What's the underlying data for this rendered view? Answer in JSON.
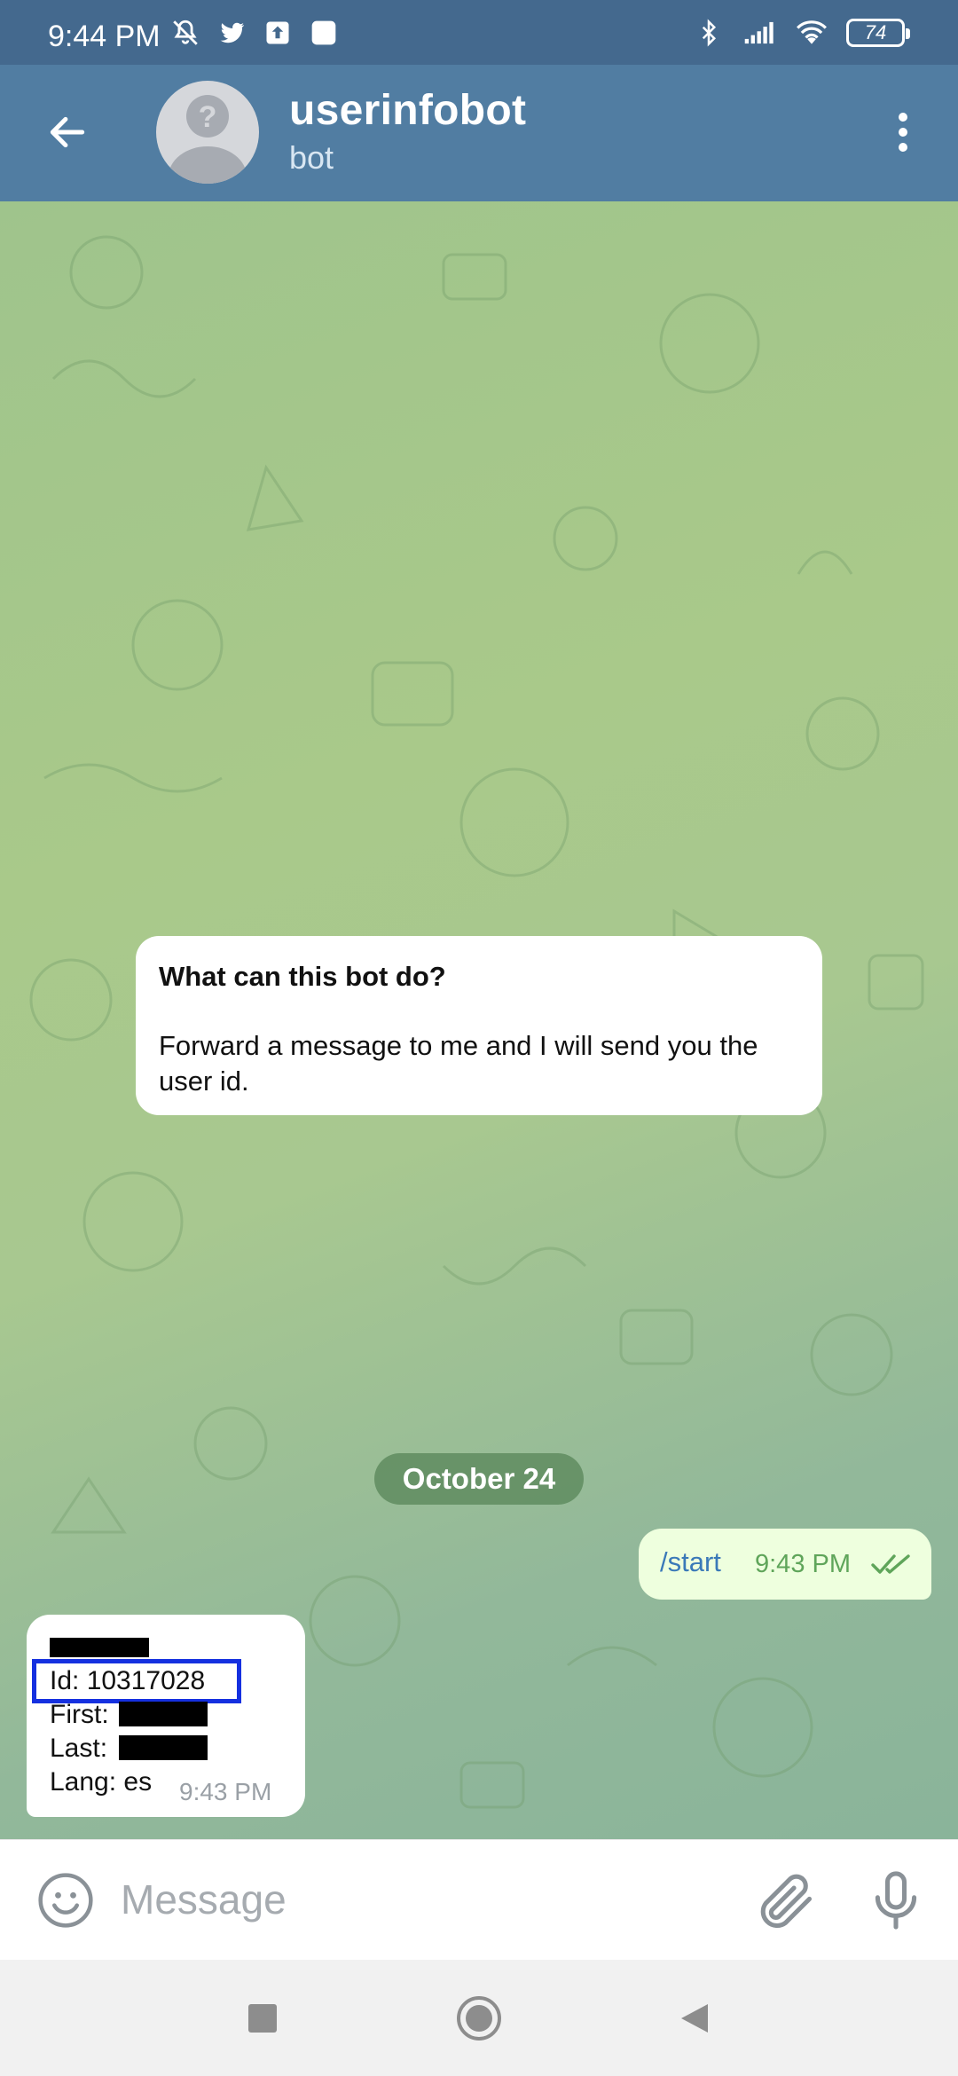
{
  "status_bar": {
    "time": "9:44 PM",
    "battery": "74",
    "icons": [
      "mute-icon",
      "twitter-icon",
      "upload-icon",
      "app-icon",
      "bluetooth-icon",
      "signal-icon",
      "wifi-icon",
      "battery-icon"
    ]
  },
  "header": {
    "title": "userinfobot",
    "subtitle": "bot",
    "icons": [
      "back-arrow-icon",
      "avatar-placeholder-icon",
      "more-vertical-icon"
    ]
  },
  "chat": {
    "bot_intro": {
      "title": "What can this bot do?",
      "body": "Forward a message to me and I will send you the user id."
    },
    "date_separator": "October 24",
    "outgoing": {
      "text": "/start",
      "time": "9:43 PM",
      "status_icon": "double-check-icon"
    },
    "incoming": {
      "id_line": "Id: 10317028",
      "first_label": "First:",
      "last_label": "Last:",
      "lang_line": "Lang: es",
      "time": "9:43 PM"
    }
  },
  "composer": {
    "placeholder": "Message",
    "icons": [
      "emoji-icon",
      "attach-icon",
      "mic-icon"
    ]
  },
  "nav": {
    "icons": [
      "recents-square-icon",
      "home-circle-icon",
      "back-triangle-icon"
    ]
  },
  "colors": {
    "header_bg": "#517da2",
    "status_bg": "#44698e",
    "outgoing_bubble": "#eeffde",
    "highlight_box": "#1530e0"
  }
}
